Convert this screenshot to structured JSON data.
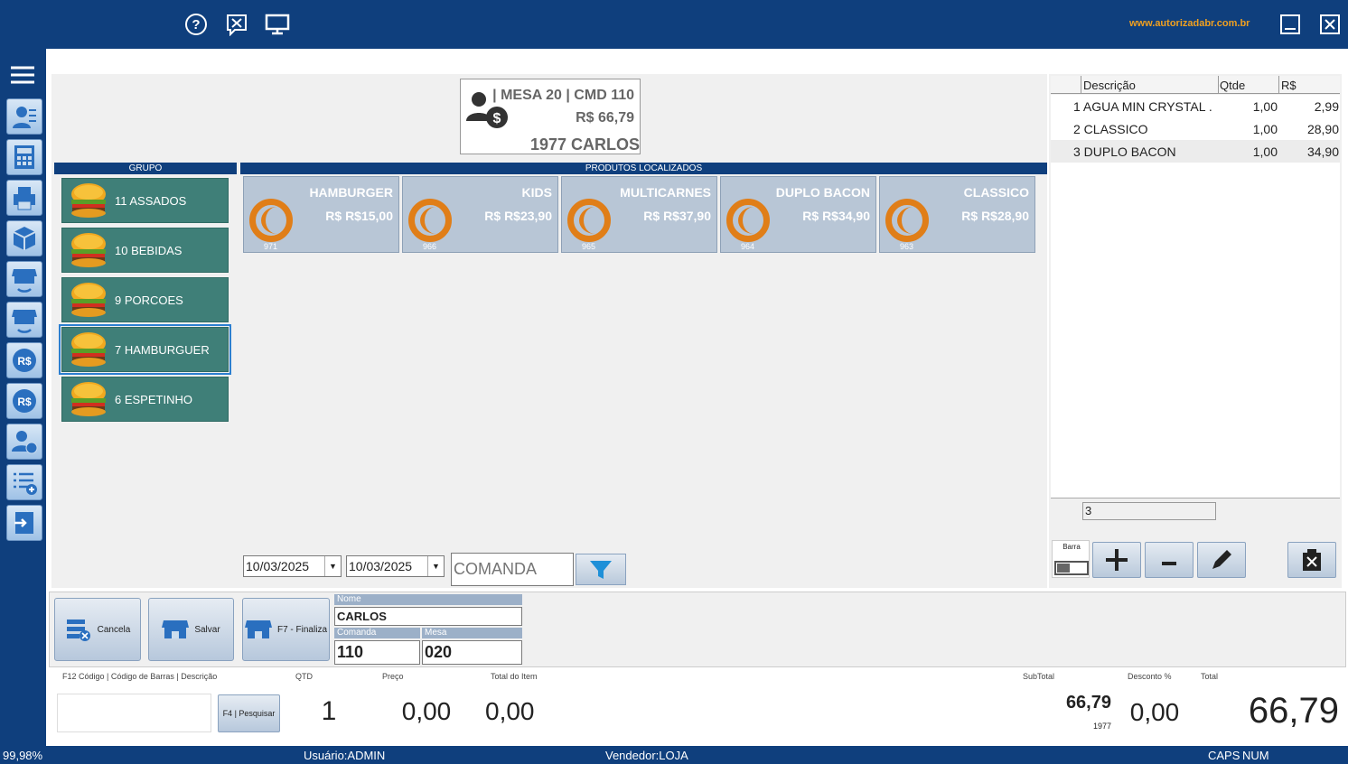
{
  "topbar": {
    "site": "www.autorizadabr.com.br",
    "icons": [
      "help-icon",
      "tools-chat-icon",
      "monitor-icon"
    ]
  },
  "sidebar": {
    "icons": [
      "menu-icon",
      "user-card-icon",
      "calculator-icon",
      "printer-icon",
      "box-icon",
      "store-sync-icon",
      "store-refresh-icon",
      "cash-icon",
      "cash-icon-2",
      "user-money-icon",
      "list-add-icon",
      "exit-icon"
    ]
  },
  "ticket": {
    "line1": "| MESA 20 | CMD 110",
    "line2": "R$ 66,79",
    "line3": "1977 CARLOS"
  },
  "groups": {
    "header": "GRUPO",
    "items": [
      {
        "label": "11 ASSADOS"
      },
      {
        "label": "10 BEBIDAS"
      },
      {
        "label": "9 PORCOES"
      },
      {
        "label": "7 HAMBURGUER",
        "selected": true
      },
      {
        "label": "6 ESPETINHO"
      }
    ]
  },
  "products": {
    "header": "PRODUTOS LOCALIZADOS",
    "items": [
      {
        "name": "HAMBURGER",
        "price": "R$ R$15,00",
        "code": "971"
      },
      {
        "name": "KIDS",
        "price": "R$ R$23,90",
        "code": "966"
      },
      {
        "name": "MULTICARNES",
        "price": "R$ R$37,90",
        "code": "965"
      },
      {
        "name": "DUPLO BACON",
        "price": "R$ R$34,90",
        "code": "964"
      },
      {
        "name": "CLASSICO",
        "price": "R$ R$28,90",
        "code": "963"
      }
    ]
  },
  "filters": {
    "date_from": "10/03/2025",
    "date_to": "10/03/2025",
    "comanda_placeholder": "COMANDA"
  },
  "items_table": {
    "headers": [
      "Descrição",
      "Qtde",
      "R$"
    ],
    "rows": [
      {
        "desc": "1 AGUA MIN CRYSTAL ...",
        "qty": "1,00",
        "value": "2,99"
      },
      {
        "desc": "2 CLASSICO",
        "qty": "1,00",
        "value": "28,90"
      },
      {
        "desc": "3 DUPLO BACON",
        "qty": "1,00",
        "value": "34,90"
      }
    ],
    "count": "3"
  },
  "barra_label": "Barra",
  "actions": {
    "cancel": "Cancela",
    "save": "Salvar",
    "finish": "F7 - Finaliza"
  },
  "customer": {
    "name_label": "Nome",
    "name": "CARLOS",
    "comanda_label": "Comanda",
    "comanda": "110",
    "mesa_label": "Mesa",
    "mesa": "020"
  },
  "entry": {
    "code_label": "F12  Código | Código de Barras | Descrição",
    "search_button": "F4 | Pesquisar",
    "qty_label": "QTD",
    "qty": "1",
    "price_label": "Preço",
    "price": "0,00",
    "item_total_label": "Total do Item",
    "item_total": "0,00",
    "subtotal_label": "SubTotal",
    "subtotal": "66,79",
    "subtotal_code": "1977",
    "discount_label": "Desconto %",
    "discount": "0,00",
    "total_label": "Total",
    "total": "66,79"
  },
  "status": {
    "zoom": "99,98%",
    "user": "Usuário:ADMIN",
    "seller": "Vendedor:LOJA",
    "caps": "CAPS",
    "num": "NUM"
  }
}
